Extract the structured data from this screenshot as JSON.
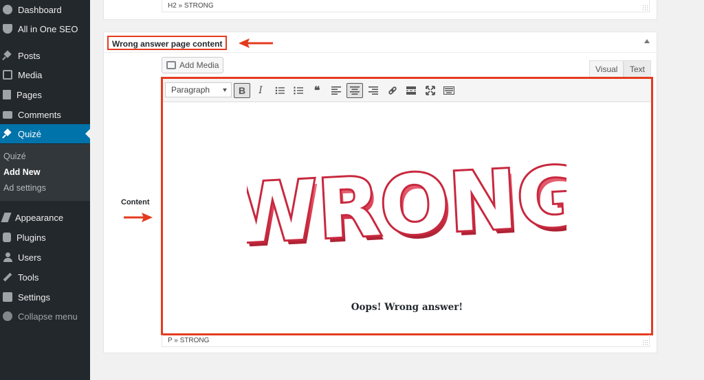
{
  "sidebar": {
    "items": [
      {
        "label": "Dashboard",
        "icon": "dashboard-icon"
      },
      {
        "label": "All in One SEO",
        "icon": "shield-icon"
      },
      {
        "label": "Posts",
        "icon": "pin-icon"
      },
      {
        "label": "Media",
        "icon": "media-icon"
      },
      {
        "label": "Pages",
        "icon": "pages-icon"
      },
      {
        "label": "Comments",
        "icon": "comment-icon"
      },
      {
        "label": "Quizé",
        "icon": "pin-icon",
        "active": true
      }
    ],
    "submenu": [
      "Quizé",
      "Add New",
      "Ad settings"
    ],
    "items_lower": [
      {
        "label": "Appearance",
        "icon": "brush-icon"
      },
      {
        "label": "Plugins",
        "icon": "plug-icon"
      },
      {
        "label": "Users",
        "icon": "user-icon"
      },
      {
        "label": "Tools",
        "icon": "wrench-icon"
      },
      {
        "label": "Settings",
        "icon": "settings-icon"
      }
    ],
    "collapse_label": "Collapse menu"
  },
  "top_editor": {
    "path": "H2 » STRONG"
  },
  "box": {
    "title": "Wrong answer page content",
    "field_label": "Content",
    "add_media_label": "Add Media",
    "tabs": {
      "visual": "Visual",
      "text": "Text"
    },
    "format_select": "Paragraph",
    "toolbar_icons": [
      "bold-icon",
      "italic-icon",
      "bullet-list-icon",
      "numbered-list-icon",
      "blockquote-icon",
      "align-left-icon",
      "align-center-icon",
      "align-right-icon",
      "link-icon",
      "read-more-icon",
      "fullscreen-icon",
      "toolbar-toggle-icon"
    ],
    "bold_glyph": "B",
    "italic_glyph": "I",
    "quote_glyph": "❝",
    "image_word": "WRONG",
    "caption": "Oops! Wrong answer!",
    "path": "P » STRONG"
  },
  "colors": {
    "annotation_red": "#e53a1e",
    "sidebar_bg": "#23282d",
    "active_blue": "#0073aa"
  }
}
